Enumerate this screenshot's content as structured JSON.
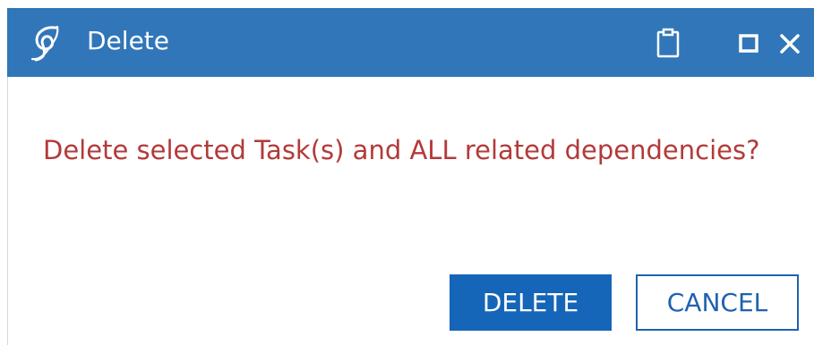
{
  "window": {
    "title": "Delete",
    "logo_icon": "app-swirl-logo-icon",
    "clipboard_icon": "clipboard-icon",
    "maximize_icon": "maximize-icon",
    "close_icon": "close-icon",
    "titlebar_color": "#3176b8"
  },
  "message": {
    "text": "Delete selected Task(s) and ALL related dependencies?",
    "color": "#b33a3a"
  },
  "buttons": {
    "delete_label": "DELETE",
    "cancel_label": "CANCEL",
    "primary_color": "#1565b8"
  }
}
